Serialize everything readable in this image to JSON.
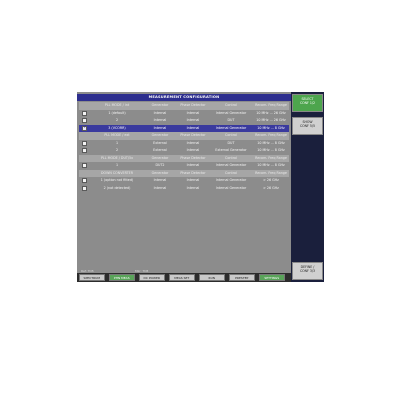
{
  "dialog": {
    "title": "MEASUREMENT CONFIGURATION"
  },
  "sections": [
    {
      "header": [
        "PLL MODE / int",
        "Generator",
        "Phase Detector",
        "Control",
        "Recom. Freq Range"
      ],
      "rows": [
        {
          "checked": false,
          "selected": false,
          "cells": [
            "1 (default)",
            "Internal",
            "Internal",
            "Internal Generator",
            "10 MHz ... 26 GHz"
          ]
        },
        {
          "checked": false,
          "selected": false,
          "cells": [
            "2",
            "Internal",
            "Internal",
            "DUT",
            "10 MHz ... 26 GHz"
          ]
        },
        {
          "checked": true,
          "selected": true,
          "cells": [
            "3 (VCORR)",
            "Internal",
            "Internal",
            "Internal Generator",
            "10 MHz ... 8 GHz"
          ]
        }
      ]
    },
    {
      "header": [
        "PLL MODE / ext",
        "Generator",
        "Phase Detector",
        "Control",
        "Recom. Freq Range"
      ],
      "rows": [
        {
          "checked": false,
          "selected": false,
          "cells": [
            "1",
            "External",
            "Internal",
            "DUT",
            "10 MHz ... 8 GHz"
          ]
        },
        {
          "checked": false,
          "selected": false,
          "cells": [
            "2",
            "External",
            "Internal",
            "External Generator",
            "10 MHz ... 8 GHz"
          ]
        }
      ]
    },
    {
      "header": [
        "PLL MODE / DUT/5x",
        "Generator",
        "Phase Detector",
        "Control",
        "Recom. Freq Range"
      ],
      "rows": [
        {
          "checked": false,
          "selected": false,
          "cells": [
            "1",
            "DUT2",
            "Internal",
            "Internal Generator",
            "10 MHz ... 8 GHz"
          ]
        }
      ]
    },
    {
      "header": [
        "DOWN CONVERTER",
        "Generator",
        "Phase Detector",
        "Control",
        "Recom. Freq Range"
      ],
      "rows": [
        {
          "checked": false,
          "selected": false,
          "cells": [
            "1 (option not fitted)",
            "Internal",
            "Internal",
            "Internal Generator",
            "> 26 GHz"
          ]
        },
        {
          "checked": false,
          "selected": false,
          "cells": [
            "2 (not detected)",
            "Internal",
            "Internal",
            "Internal Generator",
            "> 26 GHz"
          ]
        }
      ]
    }
  ],
  "status": {
    "left": "Ref: TCB",
    "right": "Mkr: TCB"
  },
  "softkeys": [
    {
      "label": "SPECTRUM",
      "green": false
    },
    {
      "label": "PHN MEAS",
      "green": true
    },
    {
      "label": "DC POWER",
      "green": false
    },
    {
      "label": "MEAS SET",
      "green": false
    },
    {
      "label": "RUN",
      "green": false
    },
    {
      "label": "PRESTEP",
      "green": false
    },
    {
      "label": "SETTINGS",
      "green": true
    }
  ],
  "sidekeys": [
    {
      "line1": "SELECT",
      "line2": "CONF 1/2",
      "green": true
    },
    {
      "line1": "SHOW",
      "line2": "CONF 5/5",
      "green": false
    },
    {
      "line1": "DEFINE /",
      "line2": "CONF 3/3",
      "green": false
    }
  ]
}
